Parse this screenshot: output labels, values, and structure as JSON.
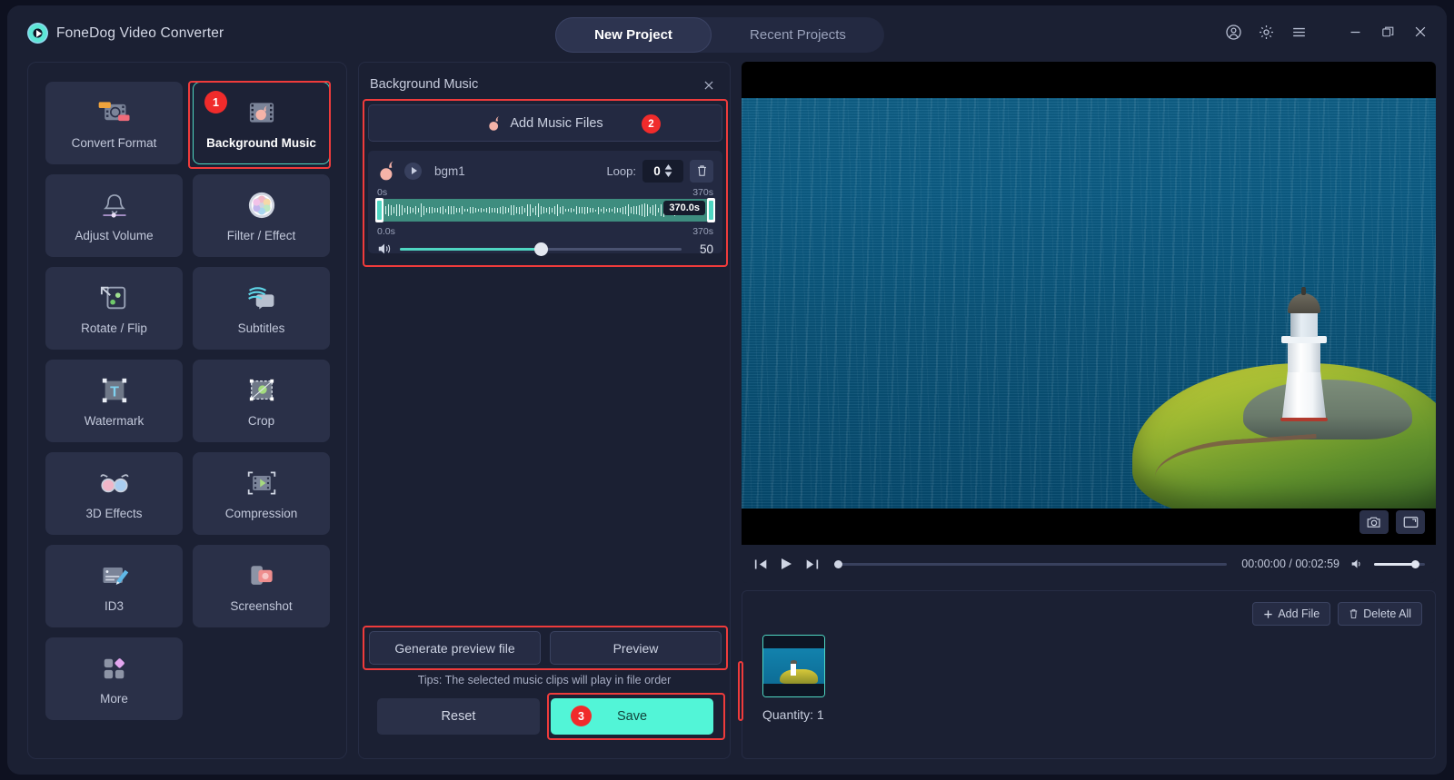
{
  "app": {
    "brand": "FoneDog Video Converter",
    "logo_icon": "play-circle-logo"
  },
  "header": {
    "tabs": [
      {
        "label": "New Project",
        "active": true
      },
      {
        "label": "Recent Projects",
        "active": false
      }
    ],
    "window_icons": [
      "account-icon",
      "gear-icon",
      "menu-icon",
      "minimize-icon",
      "maximize-icon",
      "close-icon"
    ]
  },
  "sidebar": {
    "tools": [
      {
        "label": "Convert Format",
        "icon": "convert-format-icon",
        "selected": false
      },
      {
        "label": "Background Music",
        "icon": "background-music-icon",
        "selected": true,
        "badge": "1"
      },
      {
        "label": "Adjust Volume",
        "icon": "adjust-volume-icon",
        "selected": false
      },
      {
        "label": "Filter / Effect",
        "icon": "filter-effect-icon",
        "selected": false
      },
      {
        "label": "Rotate / Flip",
        "icon": "rotate-flip-icon",
        "selected": false
      },
      {
        "label": "Subtitles",
        "icon": "subtitles-icon",
        "selected": false
      },
      {
        "label": "Watermark",
        "icon": "watermark-icon",
        "selected": false
      },
      {
        "label": "Crop",
        "icon": "crop-icon",
        "selected": false
      },
      {
        "label": "3D Effects",
        "icon": "3d-effects-icon",
        "selected": false
      },
      {
        "label": "Compression",
        "icon": "compression-icon",
        "selected": false
      },
      {
        "label": "ID3",
        "icon": "id3-icon",
        "selected": false
      },
      {
        "label": "Screenshot",
        "icon": "screenshot-icon",
        "selected": false
      },
      {
        "label": "More",
        "icon": "more-icon",
        "selected": false
      }
    ]
  },
  "panel": {
    "title": "Background Music",
    "close_icon": "close-icon",
    "add_music": {
      "label": "Add Music Files",
      "icon": "music-note-icon",
      "badge": "2"
    },
    "track": {
      "name": "bgm1",
      "note_icon": "music-note-icon",
      "play_icon": "play-icon",
      "loop_label": "Loop:",
      "loop_value": "0",
      "delete_icon": "trash-icon",
      "trim_start_label": "0s",
      "trim_end_label": "370s",
      "range_start_label": "0.0s",
      "range_end_label": "370s",
      "selection_duration": "370.0s",
      "volume_icon": "speaker-icon",
      "volume_value": "50"
    },
    "generate_preview_label": "Generate preview file",
    "preview_label": "Preview",
    "tips": "Tips: The selected music clips will play in file order",
    "reset_label": "Reset",
    "save_label": "Save",
    "save_badge": "3"
  },
  "preview": {
    "image_alt": "lighthouse-on-headland-over-ocean",
    "snapshot_icon": "camera-icon",
    "fullscreen_icon": "fullscreen-icon",
    "prev_icon": "skip-previous-icon",
    "play_icon": "play-icon",
    "next_icon": "skip-next-icon",
    "timecode": "00:00:00 / 00:02:59",
    "volume_icon": "speaker-icon"
  },
  "files": {
    "add_file_label": "Add File",
    "add_file_icon": "plus-icon",
    "delete_all_label": "Delete All",
    "delete_all_icon": "trash-icon",
    "thumbnail_alt": "lighthouse-video-thumbnail",
    "quantity": "Quantity: 1"
  },
  "colors": {
    "accent_teal": "#4fd6c2",
    "save_button": "#52f5d7",
    "badge_red": "#f02b2b",
    "highlight_red": "#ef3b3b",
    "panel_bg": "#1b2033",
    "tile_bg": "#2a3048"
  }
}
